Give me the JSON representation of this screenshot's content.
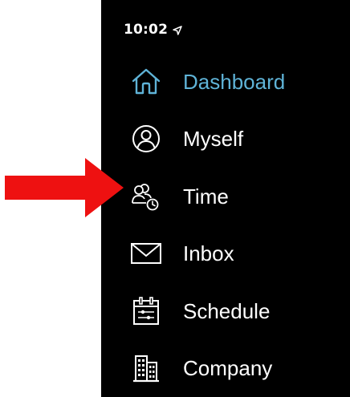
{
  "status_bar": {
    "time": "10:02",
    "location_icon": "location-arrow-icon"
  },
  "colors": {
    "panel_background": "#000000",
    "active_accent": "#5fb3d7",
    "text": "#ffffff",
    "annotation_arrow": "#ee1111"
  },
  "menu": {
    "items": [
      {
        "label": "Dashboard",
        "icon": "home-icon",
        "active": true
      },
      {
        "label": "Myself",
        "icon": "user-circle-icon",
        "active": false
      },
      {
        "label": "Time",
        "icon": "people-clock-icon",
        "active": false
      },
      {
        "label": "Inbox",
        "icon": "envelope-icon",
        "active": false
      },
      {
        "label": "Schedule",
        "icon": "calendar-icon",
        "active": false
      },
      {
        "label": "Company",
        "icon": "building-icon",
        "active": false
      }
    ]
  },
  "annotation": {
    "arrow_icon": "red-arrow-icon",
    "points_to": "Time"
  }
}
